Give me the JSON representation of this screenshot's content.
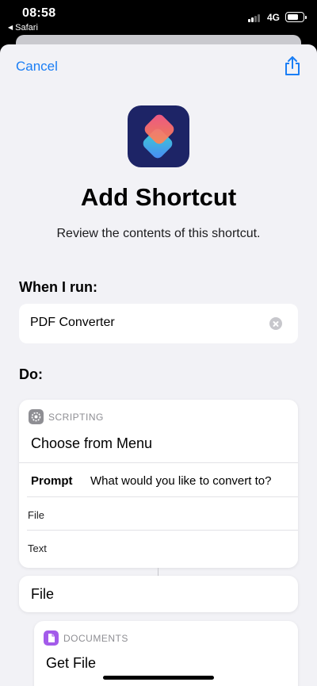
{
  "status_bar": {
    "time": "08:58",
    "back_app": "Safari",
    "network": "4G"
  },
  "nav": {
    "cancel_label": "Cancel",
    "share_icon": "share-icon"
  },
  "header": {
    "title": "Add Shortcut",
    "subtitle": "Review the contents of this shortcut."
  },
  "when_i_run": {
    "label": "When I run:",
    "value": "PDF Converter"
  },
  "do_section": {
    "label": "Do:",
    "actions": [
      {
        "category": "SCRIPTING",
        "title": "Choose from Menu",
        "prompt_key": "Prompt",
        "prompt_value": "What would you like to convert to?",
        "options": [
          "File",
          "Text"
        ]
      },
      {
        "title": "File"
      },
      {
        "category": "DOCUMENTS",
        "title": "Get File"
      }
    ]
  },
  "colors": {
    "accent": "#1a7ef5",
    "sheet_background": "#f2f2f6",
    "scripting_icon": "#8e8e93",
    "documents_icon": "#a35bea"
  }
}
